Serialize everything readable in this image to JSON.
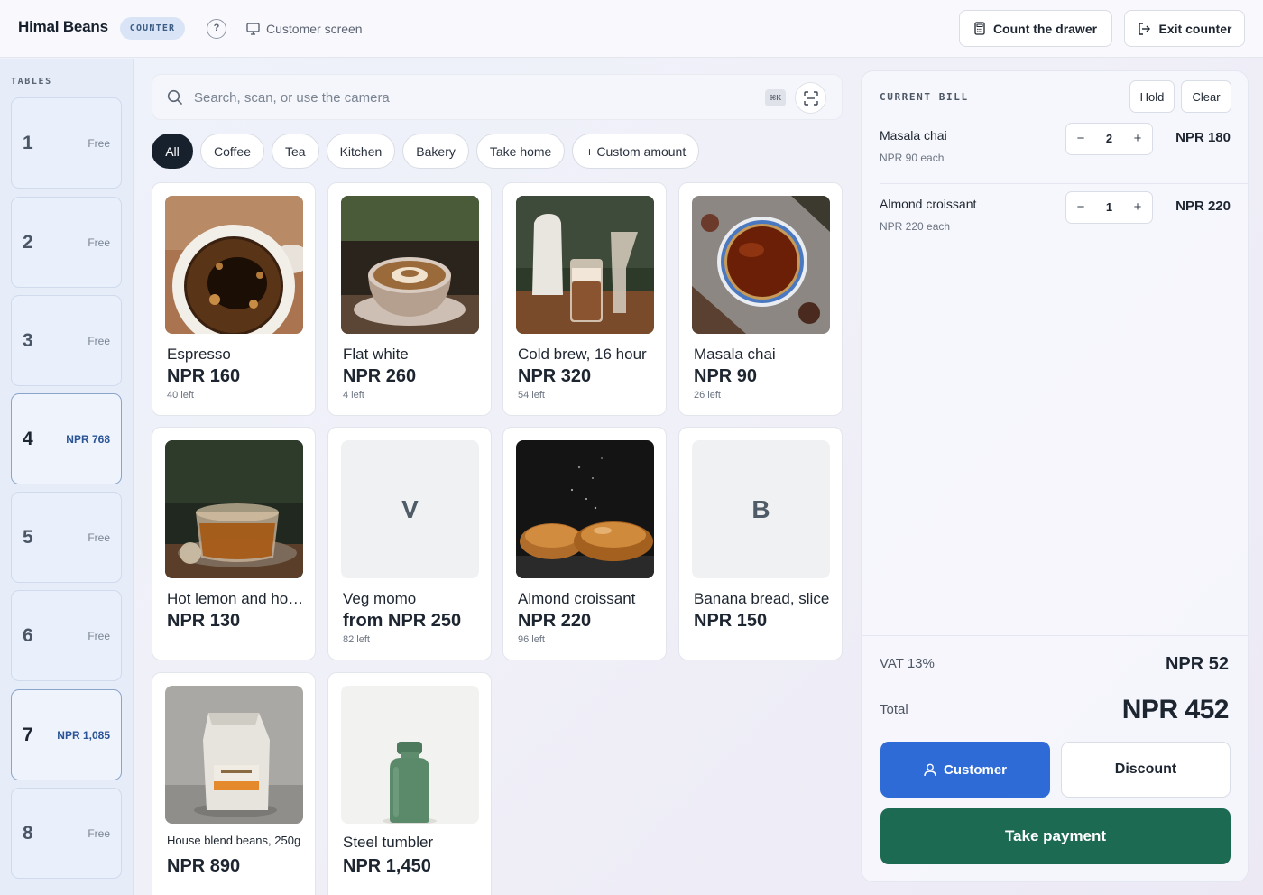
{
  "header": {
    "brand": "Himal Beans",
    "mode_badge": "COUNTER",
    "help_label": "?",
    "customer_screen_label": "Customer screen",
    "count_drawer_label": "Count the drawer",
    "exit_counter_label": "Exit counter"
  },
  "sidebar": {
    "title": "TABLES",
    "tables": [
      {
        "number": "1",
        "status": "Free"
      },
      {
        "number": "2",
        "status": "Free"
      },
      {
        "number": "3",
        "status": "Free"
      },
      {
        "number": "4",
        "status": "NPR 768"
      },
      {
        "number": "5",
        "status": "Free"
      },
      {
        "number": "6",
        "status": "Free"
      },
      {
        "number": "7",
        "status": "NPR 1,085"
      },
      {
        "number": "8",
        "status": "Free"
      }
    ]
  },
  "search": {
    "placeholder": "Search, scan, or use the camera",
    "shortcut": "⌘K"
  },
  "categories": [
    {
      "label": "All",
      "active": true
    },
    {
      "label": "Coffee",
      "active": false
    },
    {
      "label": "Tea",
      "active": false
    },
    {
      "label": "Kitchen",
      "active": false
    },
    {
      "label": "Bakery",
      "active": false
    },
    {
      "label": "Take home",
      "active": false
    },
    {
      "label": "+ Custom amount",
      "active": false
    }
  ],
  "products": [
    {
      "name": "Espresso",
      "price": "NPR 160",
      "stock": "40 left",
      "image": "espresso-photo"
    },
    {
      "name": "Flat white",
      "price": "NPR 260",
      "stock": "4 left",
      "image": "flat-white-photo"
    },
    {
      "name": "Cold brew, 16 hour",
      "price": "NPR 320",
      "stock": "54 left",
      "image": "cold-brew-photo"
    },
    {
      "name": "Masala chai",
      "price": "NPR 90",
      "stock": "26 left",
      "image": "masala-chai-photo"
    },
    {
      "name": "Hot lemon and honey",
      "price": "NPR 130",
      "stock": "",
      "image": "hot-lemon-photo"
    },
    {
      "name": "Veg momo",
      "price": "from NPR 250",
      "stock": "82 left",
      "letter": "V"
    },
    {
      "name": "Almond croissant",
      "price": "NPR 220",
      "stock": "96 left",
      "image": "croissant-photo"
    },
    {
      "name": "Banana bread, slice",
      "price": "NPR 150",
      "stock": "",
      "letter": "B"
    },
    {
      "name": "House blend beans, 250g",
      "price": "NPR 890",
      "stock": "",
      "image": "coffee-bag-photo"
    },
    {
      "name": "Steel tumbler",
      "price": "NPR 1,450",
      "stock": "",
      "image": "tumbler-photo"
    }
  ],
  "bill": {
    "title": "CURRENT BILL",
    "hold_label": "Hold",
    "clear_label": "Clear",
    "items": [
      {
        "name": "Masala chai",
        "each": "NPR 90 each",
        "qty": "2",
        "total": "NPR 180"
      },
      {
        "name": "Almond croissant",
        "each": "NPR 220 each",
        "qty": "1",
        "total": "NPR 220"
      }
    ],
    "minus_label": "−",
    "plus_label": "+",
    "vat_label": "VAT 13%",
    "vat_value": "NPR 52",
    "total_label": "Total",
    "total_value": "NPR 452",
    "customer_label": "Customer",
    "discount_label": "Discount",
    "pay_label": "Take payment"
  },
  "colors": {
    "accent_blue": "#2f6bd6",
    "pay_green": "#1c6a52",
    "busy_table_text": "#2a5496",
    "active_chip": "#17212e"
  }
}
